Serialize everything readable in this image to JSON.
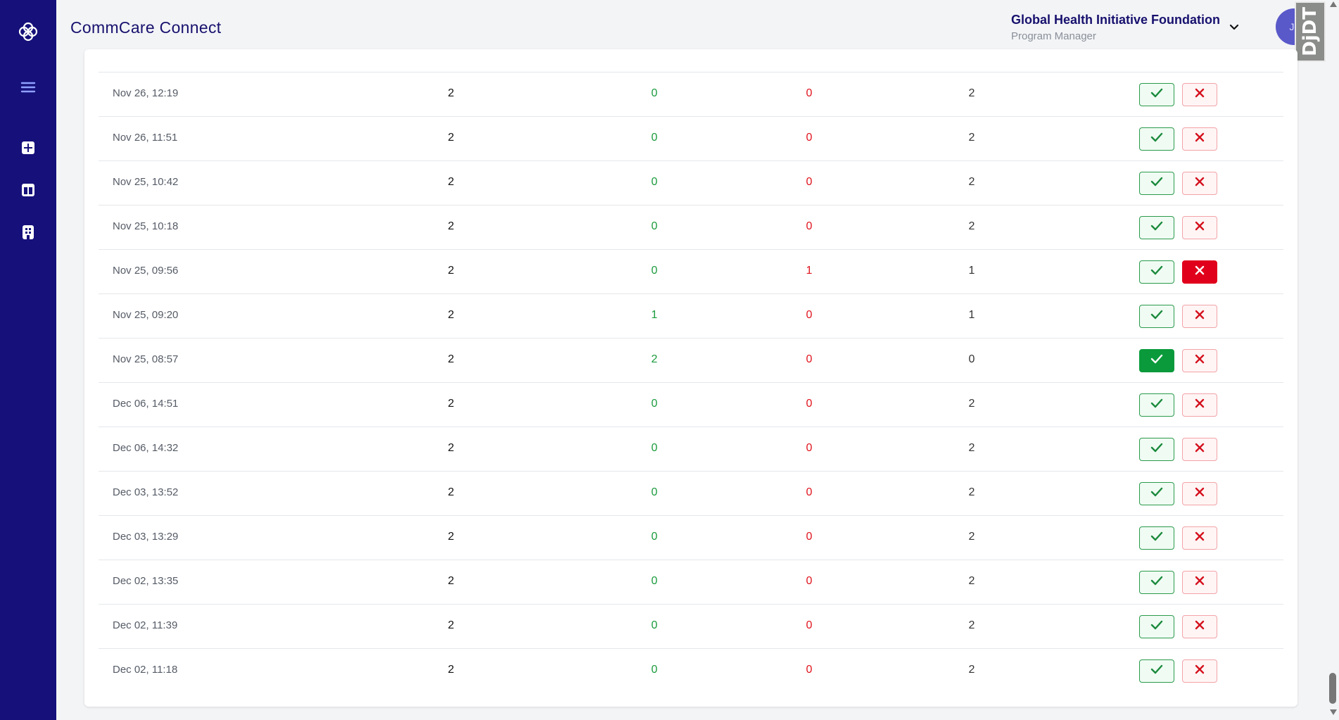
{
  "app": {
    "title": "CommCare Connect"
  },
  "org": {
    "name": "Global Health Initiative Foundation",
    "role": "Program Manager"
  },
  "user": {
    "initials": "JD"
  },
  "extension": {
    "label": "DjDT"
  },
  "colors": {
    "sidebar": "#15107a",
    "approved": "#1a9a3c",
    "rejected": "#e0141e",
    "accent": "#17116e"
  },
  "sidebar": {
    "icons": [
      "logo-icon",
      "menu-icon",
      "dashboard-grid-icon",
      "layout-icon",
      "building-icon"
    ]
  },
  "rows": [
    {
      "date": "Nov 26, 12:19",
      "total": "2",
      "approved": "0",
      "rejected": "0",
      "pending": "2",
      "approve_active": false,
      "reject_active": false
    },
    {
      "date": "Nov 26, 11:51",
      "total": "2",
      "approved": "0",
      "rejected": "0",
      "pending": "2",
      "approve_active": false,
      "reject_active": false
    },
    {
      "date": "Nov 25, 10:42",
      "total": "2",
      "approved": "0",
      "rejected": "0",
      "pending": "2",
      "approve_active": false,
      "reject_active": false
    },
    {
      "date": "Nov 25, 10:18",
      "total": "2",
      "approved": "0",
      "rejected": "0",
      "pending": "2",
      "approve_active": false,
      "reject_active": false
    },
    {
      "date": "Nov 25, 09:56",
      "total": "2",
      "approved": "0",
      "rejected": "1",
      "pending": "1",
      "approve_active": false,
      "reject_active": true
    },
    {
      "date": "Nov 25, 09:20",
      "total": "2",
      "approved": "1",
      "rejected": "0",
      "pending": "1",
      "approve_active": false,
      "reject_active": false
    },
    {
      "date": "Nov 25, 08:57",
      "total": "2",
      "approved": "2",
      "rejected": "0",
      "pending": "0",
      "approve_active": true,
      "reject_active": false
    },
    {
      "date": "Dec 06, 14:51",
      "total": "2",
      "approved": "0",
      "rejected": "0",
      "pending": "2",
      "approve_active": false,
      "reject_active": false
    },
    {
      "date": "Dec 06, 14:32",
      "total": "2",
      "approved": "0",
      "rejected": "0",
      "pending": "2",
      "approve_active": false,
      "reject_active": false
    },
    {
      "date": "Dec 03, 13:52",
      "total": "2",
      "approved": "0",
      "rejected": "0",
      "pending": "2",
      "approve_active": false,
      "reject_active": false
    },
    {
      "date": "Dec 03, 13:29",
      "total": "2",
      "approved": "0",
      "rejected": "0",
      "pending": "2",
      "approve_active": false,
      "reject_active": false
    },
    {
      "date": "Dec 02, 13:35",
      "total": "2",
      "approved": "0",
      "rejected": "0",
      "pending": "2",
      "approve_active": false,
      "reject_active": false
    },
    {
      "date": "Dec 02, 11:39",
      "total": "2",
      "approved": "0",
      "rejected": "0",
      "pending": "2",
      "approve_active": false,
      "reject_active": false
    },
    {
      "date": "Dec 02, 11:18",
      "total": "2",
      "approved": "0",
      "rejected": "0",
      "pending": "2",
      "approve_active": false,
      "reject_active": false
    }
  ]
}
